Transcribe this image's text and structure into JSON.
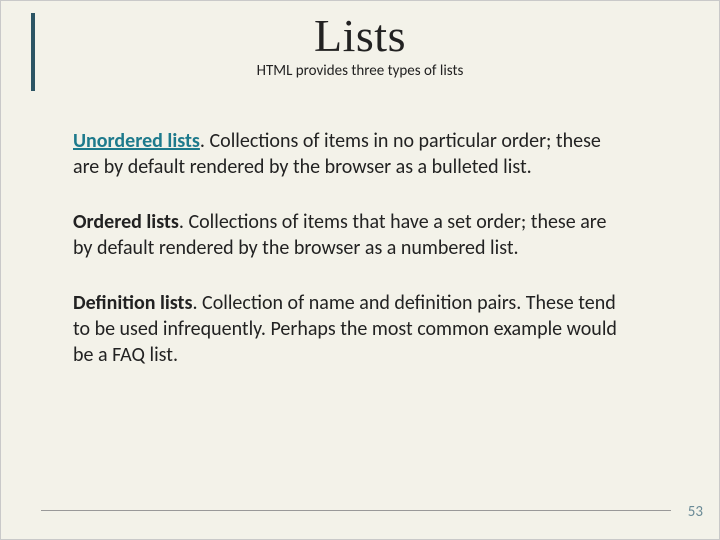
{
  "title": "Lists",
  "subtitle": "HTML provides three types of lists",
  "items": [
    {
      "term": "Unordered lists",
      "term_style": "link",
      "desc": ". Collections of items in no particular order; these are by default rendered by the browser as a bulleted list."
    },
    {
      "term": "Ordered lists",
      "term_style": "bold",
      "desc": ". Collections of items that have a set order; these are by default rendered by the browser as a numbered list."
    },
    {
      "term": "Definition lists",
      "term_style": "bold",
      "desc": ". Collection of name and definition pairs. These tend to be used infrequently. Perhaps the most common example would be a FAQ list."
    }
  ],
  "page_number": "53"
}
